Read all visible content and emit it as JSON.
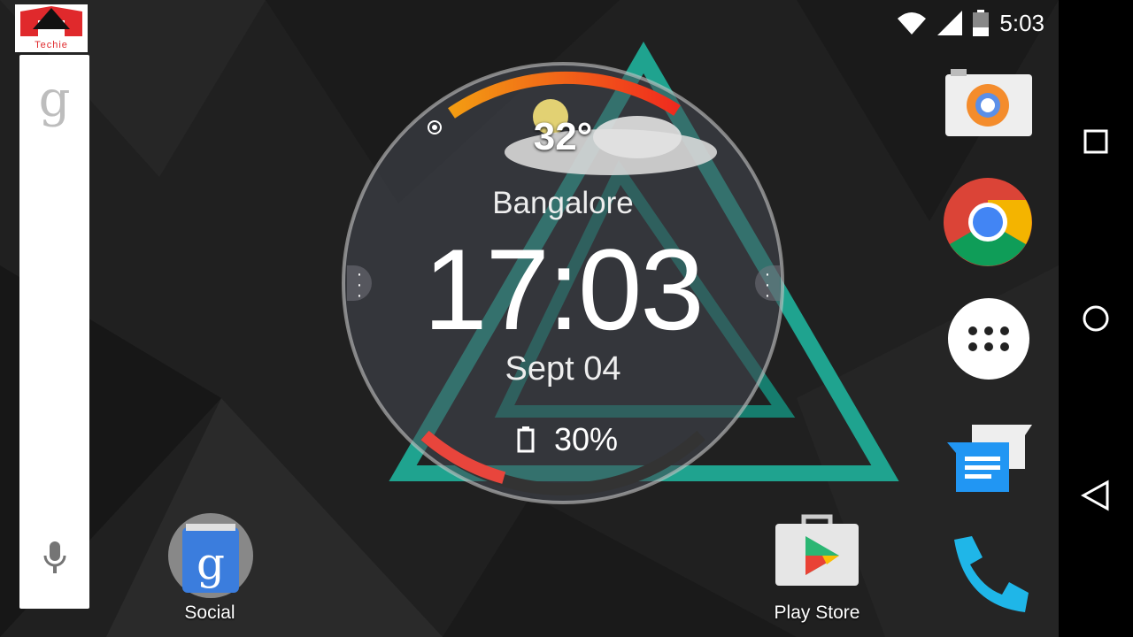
{
  "status_bar": {
    "time": "5:03",
    "icons": [
      "wifi-icon",
      "signal-icon",
      "battery-icon"
    ]
  },
  "logo": {
    "text": "Techie"
  },
  "search_widget": {
    "logo": "g",
    "icons": [
      "google-g-icon",
      "microphone-icon"
    ]
  },
  "clock_widget": {
    "temperature": "32°",
    "city": "Bangalore",
    "time": "17:03",
    "date": "Sept 04",
    "battery": "30%",
    "battery_level": 0.3,
    "weather": "partly-cloudy-icon"
  },
  "home_apps": [
    {
      "label": "Social"
    },
    {
      "label": "Play Store"
    }
  ],
  "dock": [
    "camera",
    "chrome",
    "app-drawer",
    "messenger",
    "phone"
  ],
  "nav": [
    "recents",
    "home",
    "back"
  ],
  "colors": {
    "accent_teal": "#1fa38f",
    "arc_orange": "#f39c12",
    "arc_red": "#e8453c"
  }
}
